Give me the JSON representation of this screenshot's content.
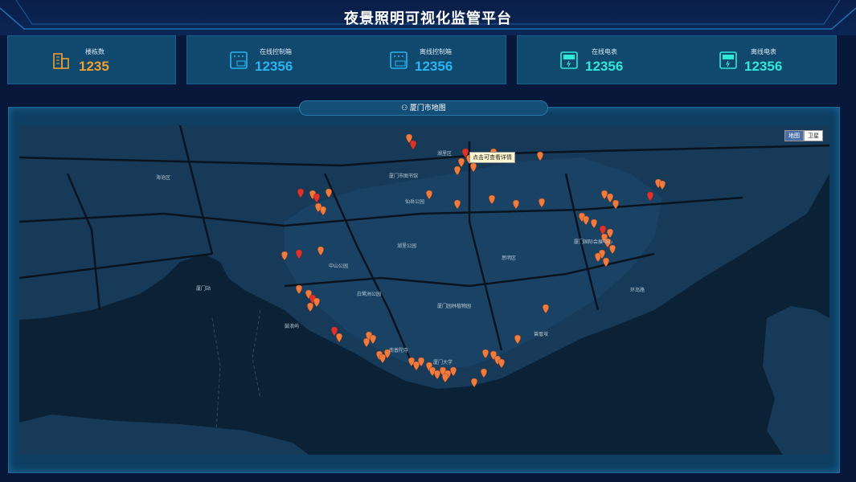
{
  "header": {
    "title": "夜景照明可视化监管平台"
  },
  "stats": [
    {
      "label": "楼栋数",
      "value": "1235",
      "icon": "building-icon",
      "color": "#f0a030"
    },
    {
      "label": "在线控制箱",
      "value": "12356",
      "icon": "control-box-on-icon",
      "color": "#27b6f2"
    },
    {
      "label": "离线控制箱",
      "value": "12356",
      "icon": "control-box-off-icon",
      "color": "#27b6f2"
    },
    {
      "label": "在线电表",
      "value": "12356",
      "icon": "meter-on-icon",
      "color": "#2ee8d8"
    },
    {
      "label": "离线电表",
      "value": "12356",
      "icon": "meter-off-icon",
      "color": "#2ee8d8"
    }
  ],
  "map": {
    "title": "厦门市地图",
    "tooltip": "点击可查看详情",
    "type_buttons": [
      "地图",
      "卫星"
    ],
    "selected_type": "地图",
    "poi_labels": [
      "厦门站",
      "厦门大学",
      "中山公园",
      "湖里公园",
      "白鹭洲公园",
      "厦门国际会展中心",
      "厦门园林植物园",
      "仙岳公园",
      "鼓浪屿",
      "海沧区",
      "厦门市图书馆",
      "南普陀寺",
      "曾厝垵",
      "环岛路",
      "思明区",
      "湖里区"
    ],
    "colors": {
      "marker": "#ef7b3e",
      "marker_dark": "#e0322a",
      "land": "#153652",
      "water": "#0b2236"
    }
  }
}
